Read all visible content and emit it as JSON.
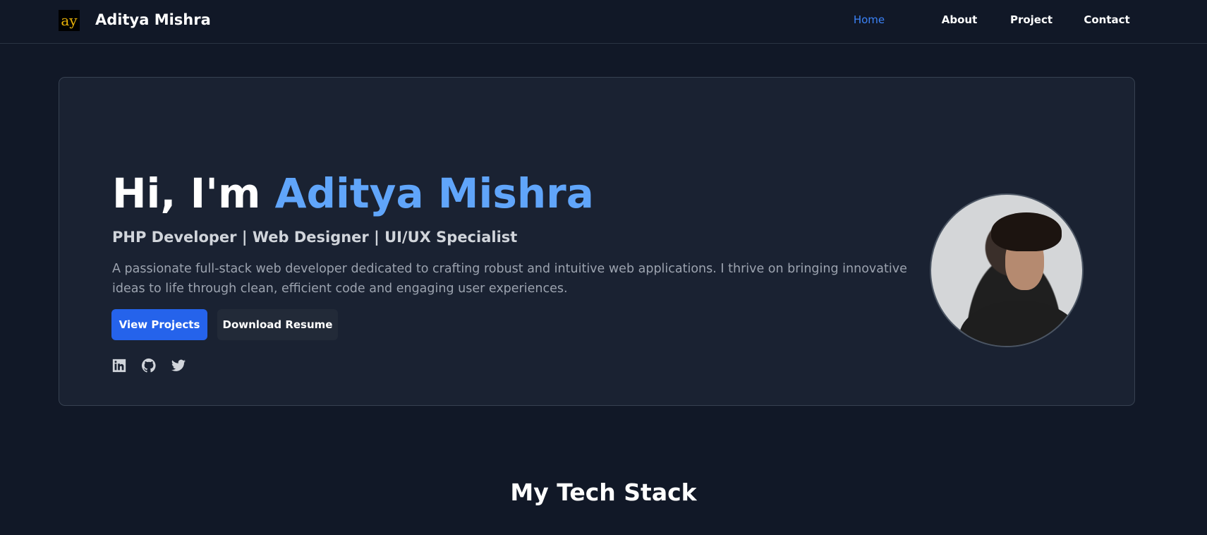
{
  "nav": {
    "logo": "ay",
    "brand": "Aditya Mishra",
    "links": [
      "Home",
      "About",
      "Project",
      "Contact"
    ],
    "active": "Home"
  },
  "hero": {
    "greeting": "Hi, I'm ",
    "name": "Aditya Mishra",
    "subtitle": "PHP Developer | Web Designer | UI/UX Specialist",
    "description": "A passionate full-stack web developer dedicated to crafting robust and intuitive web applications. I thrive on bringing innovative ideas to life through clean, efficient code and engaging user experiences.",
    "primary_button": "View Projects",
    "secondary_button": "Download Resume",
    "socials": [
      "linkedin-icon",
      "github-icon",
      "twitter-icon"
    ]
  },
  "section": {
    "title": "My Tech Stack"
  },
  "colors": {
    "accent": "#2563eb",
    "highlight": "#60a5fa",
    "bg": "#111827",
    "card": "#1a2232"
  }
}
